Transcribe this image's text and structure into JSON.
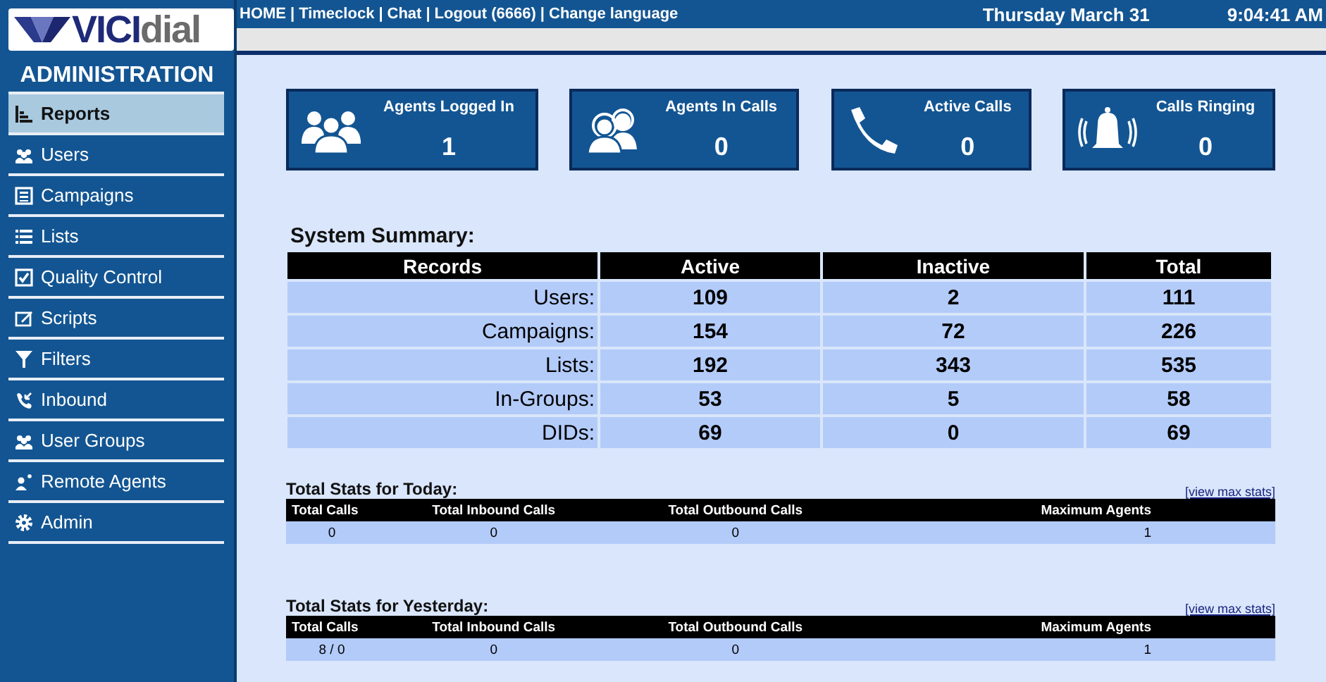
{
  "logo": {
    "bold": "VICI",
    "light": "dial"
  },
  "nav_links": [
    {
      "label": "HOME"
    },
    {
      "label": "Timeclock"
    },
    {
      "label": "Chat"
    },
    {
      "label": "Logout (6666)"
    },
    {
      "label": "Change language"
    }
  ],
  "nav_separator": "|",
  "date": "Thursday March 31",
  "time": "9:04:41 AM",
  "sidebar": {
    "title": "ADMINISTRATION",
    "items": [
      {
        "label": "Reports",
        "selected": true
      },
      {
        "label": "Users",
        "selected": false
      },
      {
        "label": "Campaigns",
        "selected": false
      },
      {
        "label": "Lists",
        "selected": false
      },
      {
        "label": "Quality Control",
        "selected": false
      },
      {
        "label": "Scripts",
        "selected": false
      },
      {
        "label": "Filters",
        "selected": false
      },
      {
        "label": "Inbound",
        "selected": false
      },
      {
        "label": "User Groups",
        "selected": false
      },
      {
        "label": "Remote Agents",
        "selected": false
      },
      {
        "label": "Admin",
        "selected": false
      }
    ]
  },
  "stat_cards": [
    {
      "label": "Agents Logged In",
      "value": "1"
    },
    {
      "label": "Agents In Calls",
      "value": "0"
    },
    {
      "label": "Active Calls",
      "value": "0"
    },
    {
      "label": "Calls Ringing",
      "value": "0"
    }
  ],
  "system_summary": {
    "title": "System Summary:",
    "columns": [
      "Records",
      "Active",
      "Inactive",
      "Total"
    ],
    "rows": [
      {
        "label": "Users:",
        "active": "109",
        "inactive": "2",
        "total": "111"
      },
      {
        "label": "Campaigns:",
        "active": "154",
        "inactive": "72",
        "total": "226"
      },
      {
        "label": "Lists:",
        "active": "192",
        "inactive": "343",
        "total": "535"
      },
      {
        "label": "In-Groups:",
        "active": "53",
        "inactive": "5",
        "total": "58"
      },
      {
        "label": "DIDs:",
        "active": "69",
        "inactive": "0",
        "total": "69"
      }
    ]
  },
  "stats_sections": [
    {
      "title": "Total Stats for Today:",
      "link": "[view max stats]",
      "columns": [
        "Total Calls",
        "Total Inbound Calls",
        "Total Outbound Calls",
        "Maximum Agents"
      ],
      "row": [
        "0",
        "0",
        "0",
        "1"
      ]
    },
    {
      "title": "Total Stats for Yesterday:",
      "link": "[view max stats]",
      "columns": [
        "Total Calls",
        "Total Inbound Calls",
        "Total Outbound Calls",
        "Maximum Agents"
      ],
      "row": [
        "8 / 0",
        "0",
        "0",
        "1"
      ]
    }
  ]
}
